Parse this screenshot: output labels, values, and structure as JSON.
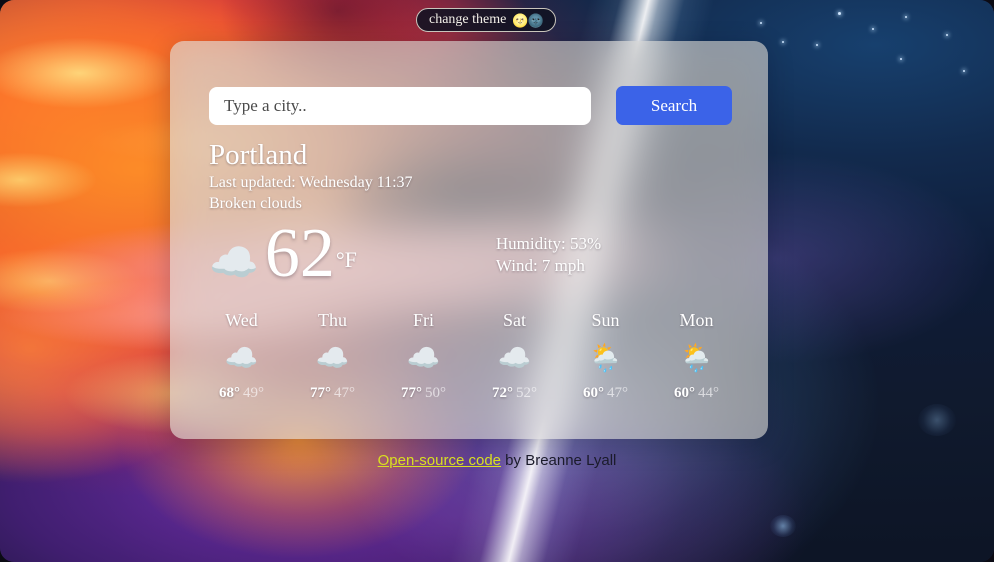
{
  "theme_toggle": {
    "label": "change theme",
    "emojis": "🌝🌚"
  },
  "search": {
    "placeholder": "Type a city..",
    "value": "",
    "button_label": "Search"
  },
  "current": {
    "city": "Portland",
    "last_updated": "Last updated: Wednesday 11:37",
    "description": "Broken clouds",
    "icon": "☁️",
    "temperature": "62",
    "unit": "°F",
    "humidity": "Humidity: 53%",
    "wind": "Wind: 7 mph"
  },
  "forecast": [
    {
      "day": "Wed",
      "icon": "☁️",
      "high": "68°",
      "low": "49°"
    },
    {
      "day": "Thu",
      "icon": "☁️",
      "high": "77°",
      "low": "47°"
    },
    {
      "day": "Fri",
      "icon": "☁️",
      "high": "77°",
      "low": "50°"
    },
    {
      "day": "Sat",
      "icon": "☁️",
      "high": "72°",
      "low": "52°"
    },
    {
      "day": "Sun",
      "icon": "🌦️",
      "high": "60°",
      "low": "47°"
    },
    {
      "day": "Mon",
      "icon": "🌦️",
      "high": "60°",
      "low": "44°"
    }
  ],
  "footer": {
    "link_text": "Open-source code",
    "credit_text": " by Breanne Lyall"
  },
  "colors": {
    "search_button": "#3b63e8",
    "footer_link": "#d9e020",
    "card_glass": "rgba(226,224,220,0.58)"
  }
}
